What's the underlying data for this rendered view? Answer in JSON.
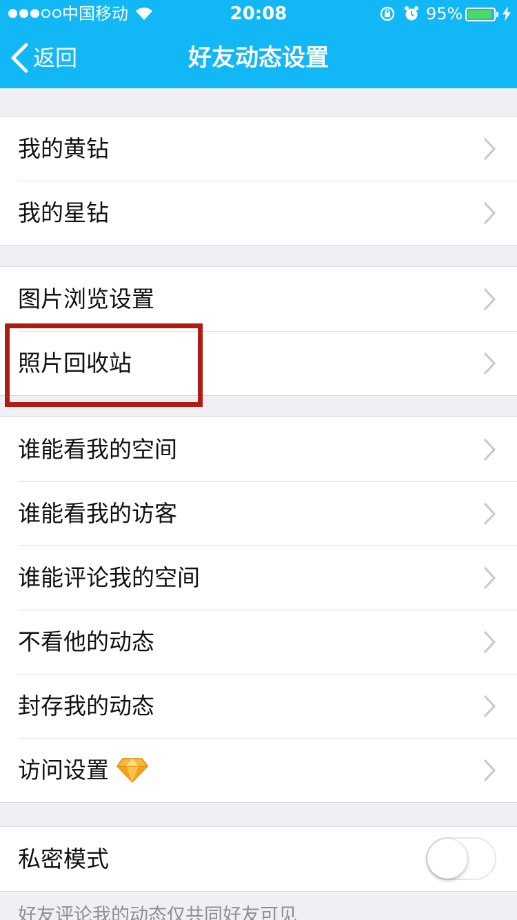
{
  "status_bar": {
    "carrier": "中国移动",
    "time": "20:08",
    "battery": "95%",
    "battery_level": 0.95,
    "signal_bars": 3,
    "signal_total": 5
  },
  "nav": {
    "back_label": "返回",
    "title": "好友动态设置"
  },
  "groups": [
    {
      "items": [
        {
          "label": "我的黄钻"
        },
        {
          "label": "我的星钻"
        }
      ]
    },
    {
      "items": [
        {
          "label": "图片浏览设置"
        },
        {
          "label": "照片回收站"
        }
      ]
    },
    {
      "items": [
        {
          "label": "谁能看我的空间"
        },
        {
          "label": "谁能看我的访客"
        },
        {
          "label": "谁能评论我的空间"
        },
        {
          "label": "不看他的动态"
        },
        {
          "label": "封存我的动态"
        },
        {
          "label": "访问设置"
        }
      ]
    }
  ],
  "private_mode": {
    "label": "私密模式",
    "enabled": false
  },
  "footnote": "好友评论我的动态仅共同好友可见",
  "colors": {
    "accent": "#12b7f5",
    "highlight": "#b01b13",
    "background": "#efeff4",
    "battery": "#4cd964",
    "gem": "#f5a623"
  }
}
